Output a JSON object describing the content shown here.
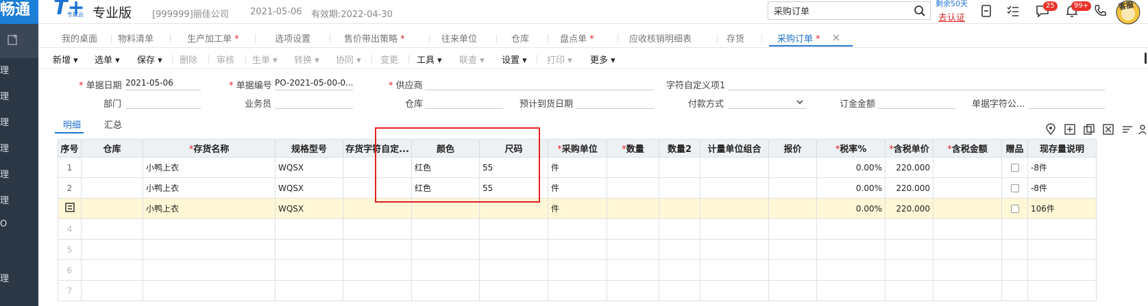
{
  "topbar": {
    "brand_left": "畅通",
    "logo_letter": "T+",
    "logo_sub": "专属云",
    "edition": "专业版",
    "company": "[999999]丽佳公司",
    "date": "2021-05-06",
    "valid": "有效期:2022-04-30",
    "search_value": "采购订单",
    "remain": "剩余50天",
    "certify": "去认证",
    "msg_badge": "25",
    "notify_badge": "99+",
    "service_label": "客服"
  },
  "rail": {
    "items": [
      "理",
      "理",
      "理",
      "理",
      "理",
      "理",
      "O",
      "理"
    ]
  },
  "tabs": [
    {
      "label": "我的桌面",
      "star": ""
    },
    {
      "label": "物料清单",
      "star": ""
    },
    {
      "label": "生产加工单",
      "star": " *"
    },
    {
      "label": "选项设置",
      "star": ""
    },
    {
      "label": "售价带出策略",
      "star": " *"
    },
    {
      "label": "往来单位",
      "star": ""
    },
    {
      "label": "仓库",
      "star": ""
    },
    {
      "label": "盘点单",
      "star": " *"
    },
    {
      "label": "应收核销明细表",
      "star": ""
    },
    {
      "label": "存货",
      "star": ""
    },
    {
      "label": "采购订单",
      "star": " *"
    }
  ],
  "toolbar": {
    "items": [
      "新增",
      "选单",
      "保存",
      "删除",
      "审核",
      "生单",
      "转换",
      "协同",
      "变更",
      "工具",
      "联查",
      "设置",
      "打印",
      "更多"
    ]
  },
  "form": {
    "doc_date_label": "单据日期",
    "doc_date": "2021-05-06",
    "doc_no_label": "单据编号",
    "doc_no": "PO-2021-05-00-0...",
    "supplier_label": "供应商",
    "supplier": "",
    "custom1_label": "字符自定义项1",
    "custom1": "",
    "dept_label": "部门",
    "salesman_label": "业务员",
    "warehouse_label": "仓库",
    "expected_date_label": "预计到货日期",
    "payment_label": "付款方式",
    "deposit_label": "订金金额",
    "custom_str_label": "单据字符公..."
  },
  "subtabs": {
    "detail": "明细",
    "summary": "汇总"
  },
  "grid": {
    "headers": [
      {
        "label": "序号",
        "req": ""
      },
      {
        "label": "仓库",
        "req": ""
      },
      {
        "label": "存货名称",
        "req": "*"
      },
      {
        "label": "规格型号",
        "req": ""
      },
      {
        "label": "存货字符自定...",
        "req": ""
      },
      {
        "label": "颜色",
        "req": ""
      },
      {
        "label": "尺码",
        "req": ""
      },
      {
        "label": "采购单位",
        "req": "*"
      },
      {
        "label": "数量",
        "req": "*"
      },
      {
        "label": "数量2",
        "req": ""
      },
      {
        "label": "计量单位组合",
        "req": ""
      },
      {
        "label": "报价",
        "req": ""
      },
      {
        "label": "税率%",
        "req": "*"
      },
      {
        "label": "含税单价",
        "req": "*"
      },
      {
        "label": "含税金额",
        "req": "*"
      },
      {
        "label": "赠品",
        "req": ""
      },
      {
        "label": "现存量说明",
        "req": ""
      }
    ],
    "rows": [
      {
        "seq": "1",
        "name": "小鸭上衣",
        "spec": "WQSX",
        "color": "红色",
        "size": "55",
        "unit": "件",
        "tax": "0.00%",
        "price": "220.000",
        "stock": "-8件",
        "hl": false
      },
      {
        "seq": "2",
        "name": "小鸭上衣",
        "spec": "WQSX",
        "color": "红色",
        "size": "55",
        "unit": "件",
        "tax": "0.00%",
        "price": "220.000",
        "stock": "-8件",
        "hl": false
      },
      {
        "seq": "",
        "name": "小鸭上衣",
        "spec": "WQSX",
        "color": "",
        "size": "",
        "unit": "件",
        "tax": "0.00%",
        "price": "220.000",
        "stock": "106件",
        "hl": true
      },
      {
        "seq": "4",
        "name": "",
        "spec": "",
        "color": "",
        "size": "",
        "unit": "",
        "tax": "",
        "price": "",
        "stock": "",
        "hl": false
      },
      {
        "seq": "5",
        "name": "",
        "spec": "",
        "color": "",
        "size": "",
        "unit": "",
        "tax": "",
        "price": "",
        "stock": "",
        "hl": false
      },
      {
        "seq": "6",
        "name": "",
        "spec": "",
        "color": "",
        "size": "",
        "unit": "",
        "tax": "",
        "price": "",
        "stock": "",
        "hl": false
      },
      {
        "seq": "7",
        "name": "",
        "spec": "",
        "color": "",
        "size": "",
        "unit": "",
        "tax": "",
        "price": "",
        "stock": "",
        "hl": false
      }
    ]
  },
  "colors": {
    "accent": "#1d72d3",
    "required": "#e02020",
    "highlight_row": "#fff7d6",
    "rail_bg": "#2b3745"
  }
}
